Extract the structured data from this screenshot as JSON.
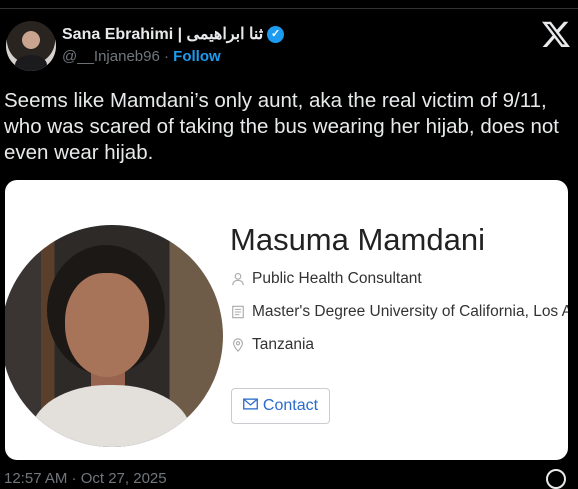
{
  "author": {
    "display_name": "Sana Ebrahimi | ثنا ابراهیمی",
    "handle": "@__Injaneb96",
    "separator": "·",
    "follow_label": "Follow"
  },
  "tweet": {
    "text": "Seems like Mamdani’s only aunt, aka the real victim of 9/11, who was scared of taking the bus wearing her hijab, does not even wear hijab."
  },
  "card": {
    "name": "Masuma Mamdani",
    "title": "Public Health Consultant",
    "education": "Master's Degree University of California, Los A",
    "location": "Tanzania",
    "contact_label": "Contact"
  },
  "meta": {
    "timestamp": "12:57 AM · Oct 27, 2025"
  },
  "colors": {
    "accent": "#1d9bf0",
    "background": "#000000",
    "card": "#ffffff"
  },
  "icons": [
    "x-logo-icon",
    "verified-badge-icon",
    "person-icon",
    "diploma-icon",
    "location-pin-icon",
    "envelope-icon",
    "info-icon"
  ]
}
